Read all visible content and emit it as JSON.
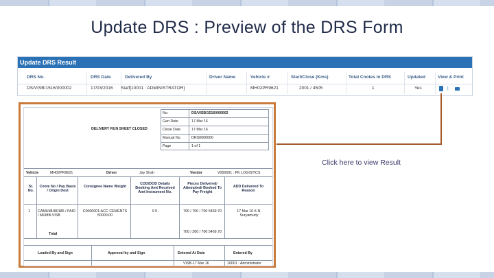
{
  "slide": {
    "title": "Update DRS : Preview of the DRS Form",
    "click_note": "Click here to view Result"
  },
  "grid": {
    "title": "Update DRS Result",
    "headers": [
      "DRS No.",
      "DRS Date",
      "Delivered By",
      "Driver Name",
      "Vehicle #",
      "Start/Close (Kms)",
      "Total Cnotes In DRS",
      "Updated",
      "View & Print"
    ],
    "row": [
      "DS/VISB/1516/000002",
      "17/03/2016",
      "Staff[10001 : ADMINISTRATOR]",
      "",
      "MH02PR9621",
      "2001 / 4505",
      "1",
      "Yes",
      ""
    ],
    "view_separator": "|"
  },
  "preview": {
    "heading": "DELIVERY RUN SHEET CLOSED",
    "info_labels": [
      "No.",
      "Gen Date",
      "Close Date",
      "Manual No.",
      "Page"
    ],
    "info_values": [
      "DS/VISB/1516/000002",
      "17 Mar 16",
      "17 Mar 16",
      "DRS0000000",
      "1 of 1"
    ],
    "vehicle_label": "Vehicle",
    "vehicle_value": "MH02PR9621",
    "driver_label": "Driver",
    "driver_value": "Jay Shah",
    "vendor_label": "Vendor",
    "vendor_value": "V000001 : PK LOGISTICS",
    "col_headers": [
      "Sr. No.",
      "Cnote No / Pay Basis / Origin Dest",
      "Consignee Name Weight",
      "COD/DOD Details Booking Amt Received Amt Instrument No.",
      "Pieces Delivered/ Attempted/ Booked To Pay Freight",
      "ADD Delivered To Reason"
    ],
    "row": {
      "sr": "1",
      "cnote": "CAMUMH80185 / PAID / MUMB-VISB",
      "consignee": "C0000001:ACC CEMENTS 50000.00",
      "cod": "0 0 -",
      "pieces": "700 / 700 / 700 5469.70",
      "add": "17 Mar 16 K.N. Suryamurty"
    },
    "total_label": "Total",
    "total_pieces": "700 / 200 / 700 5469.70",
    "footer_headers": [
      "Loaded By and Sign",
      "Approval by and Sign",
      "Entered At Date",
      "Entered By"
    ],
    "footer_values": [
      "",
      "",
      "VISB-17 Mar 16",
      "10001 : Administrator"
    ]
  }
}
